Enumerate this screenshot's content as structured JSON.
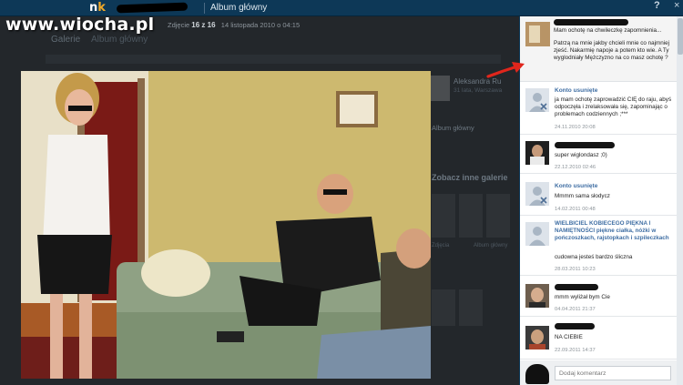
{
  "watermark": "www.wiocha.pl",
  "topbar": {
    "logo_n": "n",
    "logo_k": "k",
    "album_link": "Album główny",
    "help": "?",
    "close": "×"
  },
  "background": {
    "photo_label": "Zdjęcie",
    "photo_index": "16 z 16",
    "photo_date": "14 listopada 2010 o 04:15",
    "gallery_title": "Galerie",
    "gallery_sub": "Album główny",
    "user_name": "Aleksandra Ru",
    "user_sub": "31 lata, Warszawa",
    "galleries_label": "Album główny",
    "other_galleries": "Zobacz inne galerie",
    "cap1": "Zdjęcia",
    "cap2": "Album główny"
  },
  "panel": {
    "post_paragraphs": [
      "Mam ochotę na chwileczkę zapomnienia...",
      "Patrzą na mnie jakby chcieli mnie co najmniej zjeść. Nakarmię napoje a potem kto wie. A Ty wyglodniały Mężczyzno na co masz ochotę ?"
    ],
    "comments": [
      {
        "author": "Konto usunięte",
        "text": "ja mam ochotę zaprowadzić CIĘ do raju, abyś odpoczęła i zrelaksowała się, zapominając o problemach codziennych ;***",
        "date": "24.11.2010 20:08"
      },
      {
        "author": "",
        "text": "super wiglondasz ;0)",
        "date": "22.12.2010 02:46"
      },
      {
        "author": "Konto usunięte",
        "text": "Mmmm sama słodycz",
        "date": "14.02.2011 00:48"
      },
      {
        "author": "WIELBICIEL KOBIECEGO PIĘKNA I NAMIĘTNOŚCI piękne ciałka, nóżki w pończoszkach, rajstopkach i szpileczkach",
        "text": "cudowna jesteś bardzo śliczna",
        "date": "28.03.2011 10:23"
      },
      {
        "author": "",
        "text": "mmm wyliżał bym Cie",
        "date": "04.04.2011 21:37"
      },
      {
        "author": "",
        "text": "NA CIEBIE",
        "date": "22.09.2011 14:37"
      }
    ],
    "add_comment_placeholder": "Dodaj komentarz"
  },
  "colors": {
    "topbar": "#0d3857",
    "link_blue": "#3f6ea3",
    "arrow_red": "#e0261c",
    "logo_orange": "#f0a928"
  }
}
